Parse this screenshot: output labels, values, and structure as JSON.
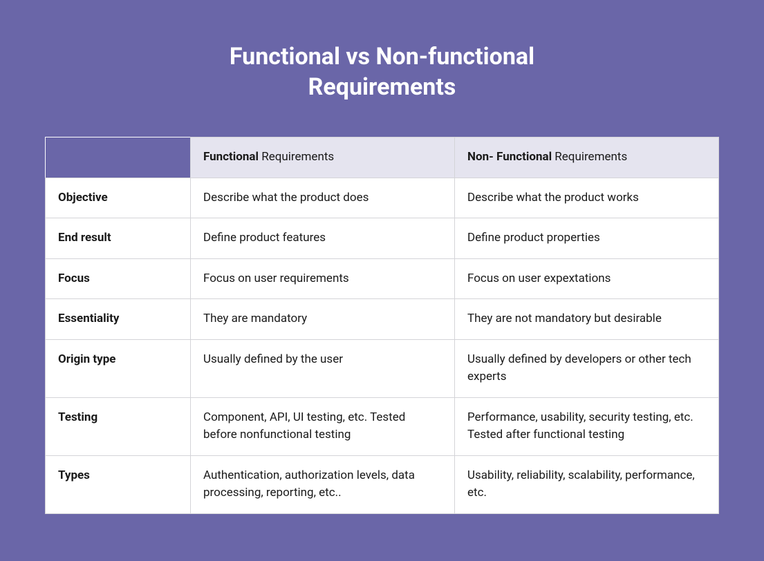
{
  "title": "Functional vs Non-functional Requirements",
  "headers": {
    "functional_bold": "Functional",
    "functional_rest": " Requirements",
    "nonfunctional_bold": "Non- Functional",
    "nonfunctional_rest": " Requirements"
  },
  "rows": [
    {
      "label": "Objective",
      "functional": "Describe what the product does",
      "nonfunctional": "Describe what the product works"
    },
    {
      "label": "End result",
      "functional": "Define product features",
      "nonfunctional": "Define product properties"
    },
    {
      "label": "Focus",
      "functional": "Focus on user requirements",
      "nonfunctional": "Focus on user expextations"
    },
    {
      "label": "Essentiality",
      "functional": "They are mandatory",
      "nonfunctional": "They are not mandatory but desirable"
    },
    {
      "label": "Origin type",
      "functional": "Usually defined by the user",
      "nonfunctional": "Usually defined by developers or other tech experts"
    },
    {
      "label": "Testing",
      "functional": "Component, API, UI testing, etc. Tested before nonfunctional testing",
      "nonfunctional": "Performance, usability, security testing, etc. Tested after functional testing"
    },
    {
      "label": "Types",
      "functional": "Authentication, authorization levels, data processing, reporting, etc..",
      "nonfunctional": "Usability, reliability, scalability, performance, etc."
    }
  ]
}
